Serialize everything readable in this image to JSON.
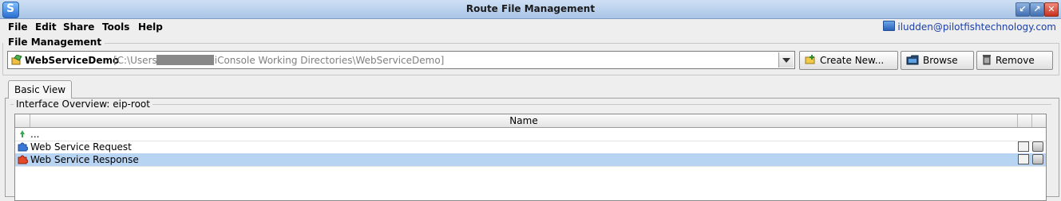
{
  "window": {
    "title": "Route File Management"
  },
  "menu": {
    "items": [
      "File",
      "Edit",
      "Share",
      "Tools",
      "Help"
    ]
  },
  "user": {
    "email": "iludden@pilotfishtechnology.com"
  },
  "file_management": {
    "label": "File Management",
    "route_name": "WebServiceDemo",
    "route_path": "[C:\\Users\\            \\PilotFish eiConsole Working Directories\\WebServiceDemo]",
    "buttons": {
      "create_new": "Create New...",
      "browse": "Browse",
      "remove": "Remove"
    }
  },
  "tabs": [
    {
      "label": "Basic View",
      "active": true
    }
  ],
  "interface_overview": {
    "label": "Interface Overview: eip-root",
    "columns": [
      "Name"
    ],
    "rows": [
      {
        "label": "...",
        "icon": "up-arrow-icon",
        "selected": false
      },
      {
        "label": "Web Service Request",
        "icon": "puzzle-blue-icon",
        "selected": false
      },
      {
        "label": "Web Service Response",
        "icon": "puzzle-red-icon",
        "selected": true
      }
    ]
  },
  "colors": {
    "selection": "#b8d4f3",
    "link": "#1a3fa8",
    "titlebar": "#a9c4e6"
  }
}
